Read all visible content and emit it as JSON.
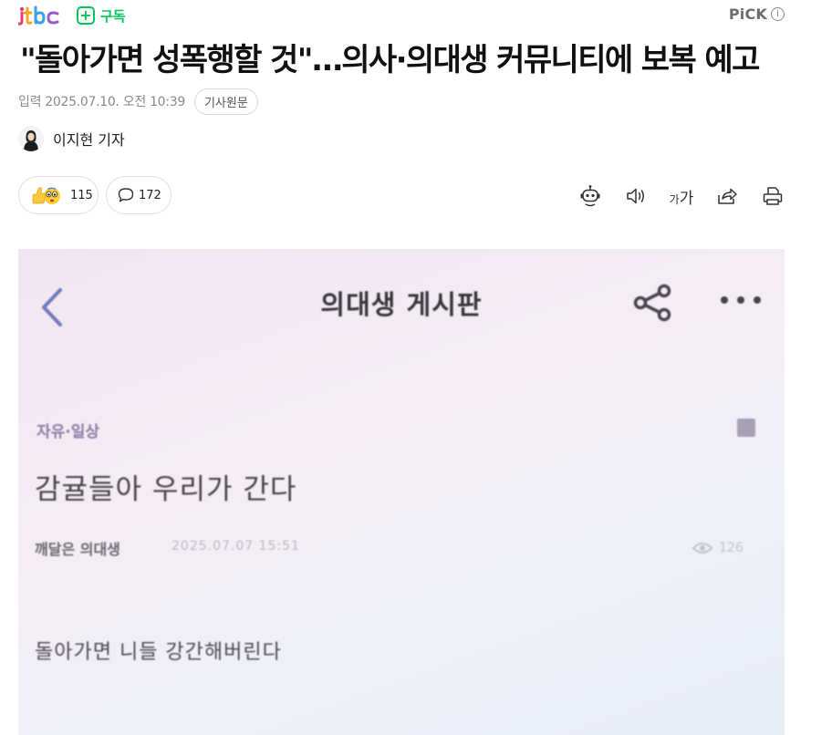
{
  "header": {
    "press_logo_text": "jtbc",
    "subscribe_label": "구독",
    "pick_label": "PiCK",
    "pick_info": "i"
  },
  "article": {
    "headline": "\"돌아가면 성폭행할 것\"…의사·의대생 커뮤니티에 보복 예고",
    "date": "입력 2025.07.10. 오전 10:39",
    "origin_button": "기사원문",
    "author": "이지현 기자"
  },
  "reactions": {
    "like_count": "115",
    "comment_count": "172"
  },
  "toolbar": {
    "fontsize_small": "가",
    "fontsize_large": "가"
  },
  "photo": {
    "board_title": "의대생 게시판",
    "category": "자유·일상",
    "post_title": "감귤들아 우리가 간다",
    "writer": "깨달은 의대생",
    "post_date": "2025.07.07 15:51",
    "views": "126",
    "body": "돌아가면 니들 강간해버린다"
  },
  "colors": {
    "accent_green": "#03c75a",
    "logo_pink": "#e63b7a",
    "logo_orange": "#f5a623",
    "logo_blue": "#3aa0e8"
  }
}
